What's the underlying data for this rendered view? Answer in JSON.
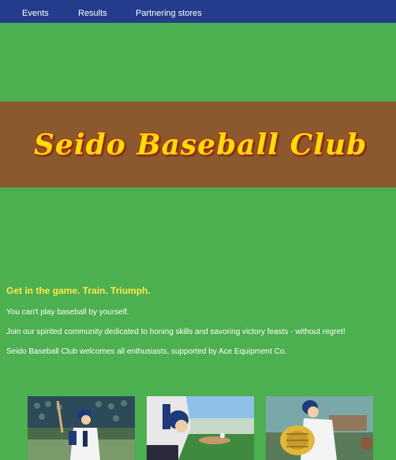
{
  "nav": {
    "items": [
      "Events",
      "Results",
      "Partnering stores"
    ]
  },
  "hero": {
    "title": "Seido Baseball Club"
  },
  "content": {
    "tagline": "Get in the game. Train. Triumph.",
    "para1": "You can't play baseball by yourself.",
    "para2": "Join our spirited community dedicated to honing skills and savoring victory feasts - without regret!",
    "para3": "Seido Baseball Club welcomes all enthusiasts, supported by Ace Equipment Co."
  },
  "colors": {
    "nav_bg": "#243c8c",
    "page_bg": "#4caf50",
    "hero_band": "#8a5a2e",
    "title_fill": "#ffe000",
    "title_outline": "#c0281b",
    "tagline": "#ffe94a"
  },
  "gallery": {
    "images": [
      "batter-at-plate-image",
      "pitcher-in-stadium-image",
      "catcher-glove-image"
    ]
  }
}
